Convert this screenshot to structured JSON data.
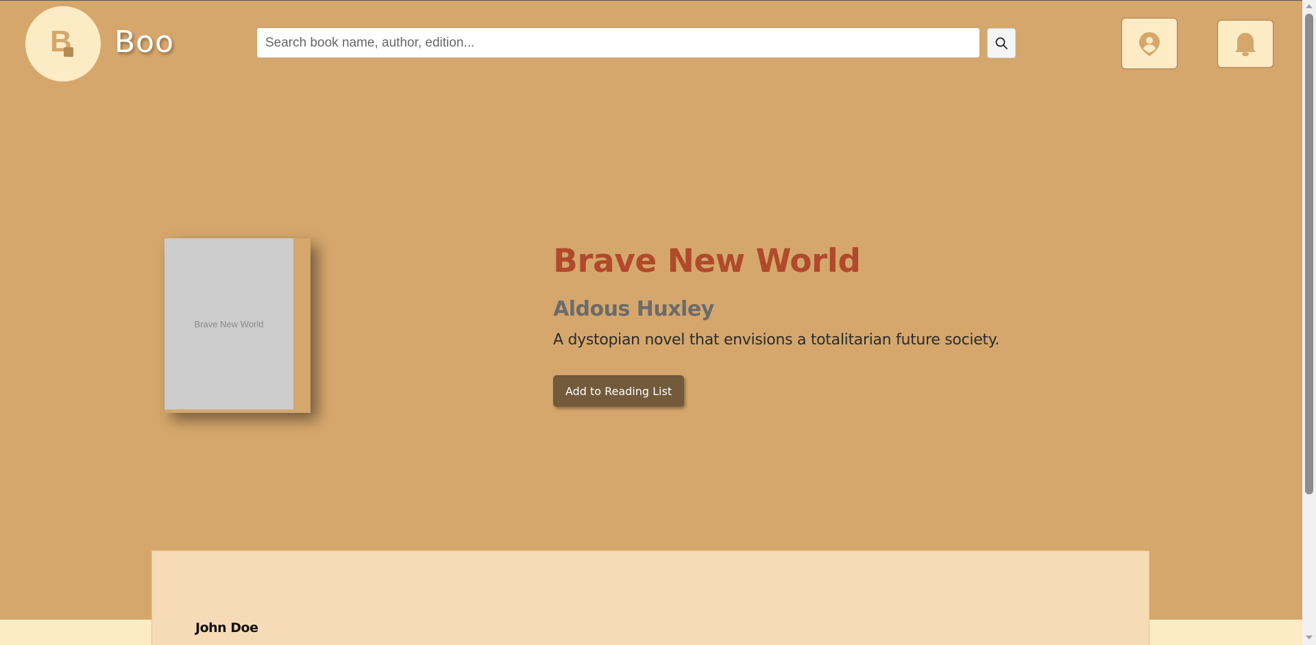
{
  "header": {
    "logo_letter": "B",
    "brand": "Boo",
    "search_placeholder": "Search book name, author, edition...",
    "search_value": ""
  },
  "book": {
    "cover_text": "Brave New World",
    "title": "Brave New World",
    "author": "Aldous Huxley",
    "description": "A dystopian novel that envisions a totalitarian future society.",
    "add_button": "Add to Reading List"
  },
  "reviews": [
    {
      "name": "John Doe"
    }
  ],
  "icons": {
    "search": "search-icon",
    "location": "location-user-icon",
    "notifications": "bell-icon"
  },
  "colors": {
    "background": "#d5a76c",
    "title": "#b04a2a",
    "button": "#725a3b",
    "panel": "#f7dab6",
    "cream": "#fdebc5"
  }
}
